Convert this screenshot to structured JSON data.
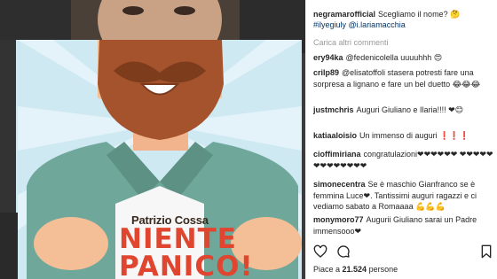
{
  "post": {
    "username": "negramarofficial",
    "caption_text": "Scegliamo il nome?",
    "caption_emoji": "🤔",
    "tags": [
      "#ilyegiuly",
      "@i.lariamacchia"
    ],
    "load_more": "Carica altri commenti",
    "likes_prefix": "Piace a ",
    "likes_count": "21.524",
    "likes_suffix": " persone"
  },
  "book": {
    "author": "Patrizio Cossa",
    "title_line1": "NIENTE",
    "title_line2": "PANICO!"
  },
  "comments": [
    {
      "user": "ery94ka",
      "text": "@fedenicolella uuuuhhh 😍"
    },
    {
      "user": "crilp89",
      "text": "@elisatoffoli stasera potresti fare una sorpresa a lignano e fare un bel duetto 😂😂😂"
    },
    {
      "user": "justmchris",
      "text": "Auguri Giuliano e Ilaria!!!! ❤😊"
    },
    {
      "user": "katiaaloisio",
      "text": "Un immenso di auguri ❗❗❗"
    },
    {
      "user": "cioffimiriana",
      "text": "congratulazioni❤❤❤❤❤❤ ❤❤❤❤❤❤❤❤❤❤❤❤❤"
    },
    {
      "user": "simonecentra",
      "text": "Se è maschio Gianfranco se è femmina Luce❤. Tantissimi auguri ragazzi e ci vediamo sabato a Romaaaa 💪💪💪"
    },
    {
      "user": "monymoro77",
      "text": "Augurii Giuliano sarai un Padre immensooo❤"
    }
  ],
  "icons": [
    "heart-icon",
    "comment-icon",
    "share-icon",
    "bookmark-icon"
  ],
  "colors": {
    "accent_title": "#e0452f",
    "shirt": "#6fa89a",
    "beard": "#a0522d",
    "sky": "#c9e6f2"
  }
}
